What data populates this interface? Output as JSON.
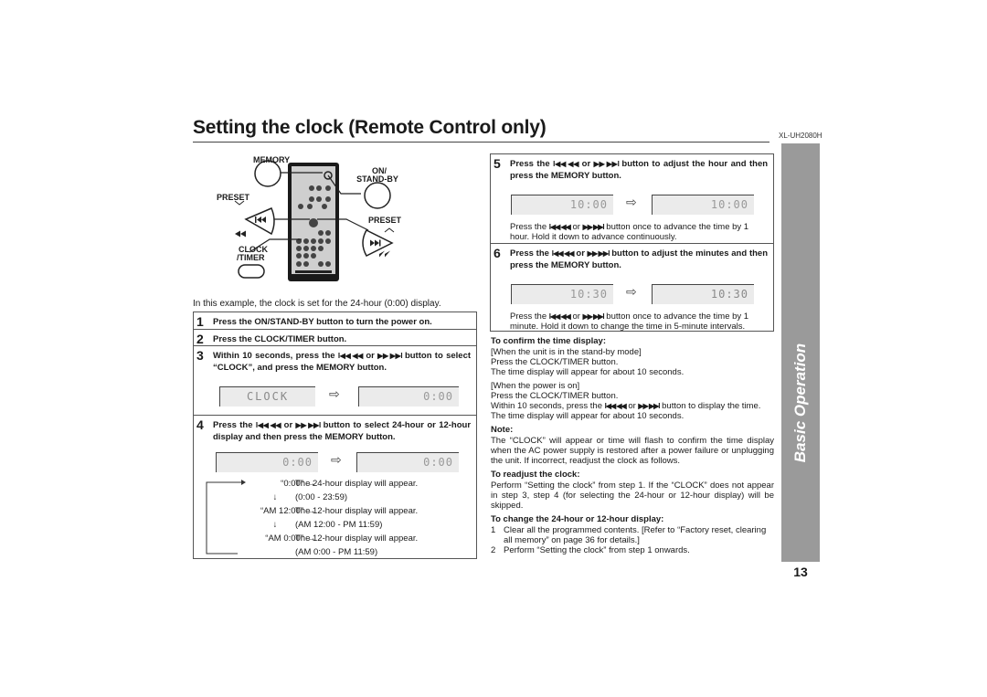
{
  "header": {
    "title": "Setting the clock (Remote Control only)",
    "model": "XL-UH2080H"
  },
  "side_tab": {
    "label": "Basic Operation",
    "color": "#9a9a9a"
  },
  "page_number": "13",
  "remote_diagram": {
    "labels": {
      "memory": "MEMORY",
      "on_standby_1": "ON/",
      "on_standby_2": "STAND-BY",
      "preset_left": "PRESET",
      "preset_right": "PRESET",
      "clock_timer_1": "CLOCK",
      "clock_timer_2": "/TIMER"
    },
    "icons": {
      "prev": "⏮",
      "rewind": "◀◀",
      "next": "⏭",
      "forward": "▶▶"
    }
  },
  "caption": "In this example, the clock is set for the 24-hour (0:00) display.",
  "buttons_symbol": {
    "back": "I◀◀ ◀◀",
    "or": "or",
    "fwd": "▶▶ ▶▶I"
  },
  "steps": [
    {
      "num": "1",
      "text": "Press the ON/STAND-BY button to turn the power on."
    },
    {
      "num": "2",
      "text": "Press the CLOCK/TIMER button."
    },
    {
      "num": "3",
      "text_pre": "Within 10 seconds, press the",
      "text_post": "button to select “CLOCK”, and press the MEMORY button.",
      "lcd_from": "CLOCK",
      "lcd_to": "0:00"
    },
    {
      "num": "4",
      "text_pre": "Press the",
      "text_post": "button to select 24-hour or 12-hour display and then press the MEMORY button.",
      "lcd_from": "0:00",
      "lcd_to": "0:00",
      "sequence": [
        {
          "value": "“0:00”",
          "desc": "The 24-hour display will appear.",
          "range": "(0:00 - 23:59)"
        },
        {
          "value": "“AM 12:00”",
          "desc": "The 12-hour display will appear.",
          "range": "(AM 12:00 - PM 11:59)"
        },
        {
          "value": "“AM 0:00”",
          "desc": "The 12-hour display will appear.",
          "range": "(AM 0:00 - PM 11:59)"
        }
      ]
    },
    {
      "num": "5",
      "text_pre": "Press the",
      "text_post": "button to adjust the hour and then press the MEMORY button.",
      "lcd_from": "10:00",
      "lcd_to": "10:00",
      "note_pre": "Press the",
      "note_post": "button once to advance the time by 1 hour. Hold it down to advance continuously."
    },
    {
      "num": "6",
      "text_pre": "Press the",
      "text_post": "button to adjust the minutes and then press the MEMORY button.",
      "lcd_from": "10:30",
      "lcd_to": "10:30",
      "note_pre": "Press the",
      "note_post": "button once to advance the time by 1 minute. Hold it down to change the time in 5-minute intervals."
    }
  ],
  "confirm": {
    "heading": "To confirm the time display:",
    "standby_cond": "[When the unit is in the stand-by mode]",
    "standby_l1": "Press the CLOCK/TIMER button.",
    "standby_l2": "The time display will appear for about 10 seconds.",
    "power_cond": "[When the power is on]",
    "power_l1": "Press the CLOCK/TIMER button.",
    "power_l2_pre": "Within 10 seconds, press the",
    "power_l2_post": "button to display the time.",
    "power_l3": "The time display will appear for about 10 seconds."
  },
  "note": {
    "heading": "Note:",
    "text": "The “CLOCK” will appear or time will flash to confirm the time display when the AC power supply is restored after a power failure or unplugging the unit. If incorrect, readjust the clock as follows."
  },
  "readjust": {
    "heading": "To readjust the clock:",
    "text": "Perform “Setting the clock” from step 1. If the “CLOCK” does not appear in step 3, step 4 (for selecting the 24-hour or 12-hour display) will be skipped."
  },
  "change_display": {
    "heading": "To change the 24-hour or 12-hour display:",
    "items": [
      {
        "num": "1",
        "text": "Clear all the programmed contents. [Refer to “Factory reset, clearing all memory” on page 36 for details.]"
      },
      {
        "num": "2",
        "text": "Perform “Setting the clock” from step 1 onwards."
      }
    ]
  }
}
